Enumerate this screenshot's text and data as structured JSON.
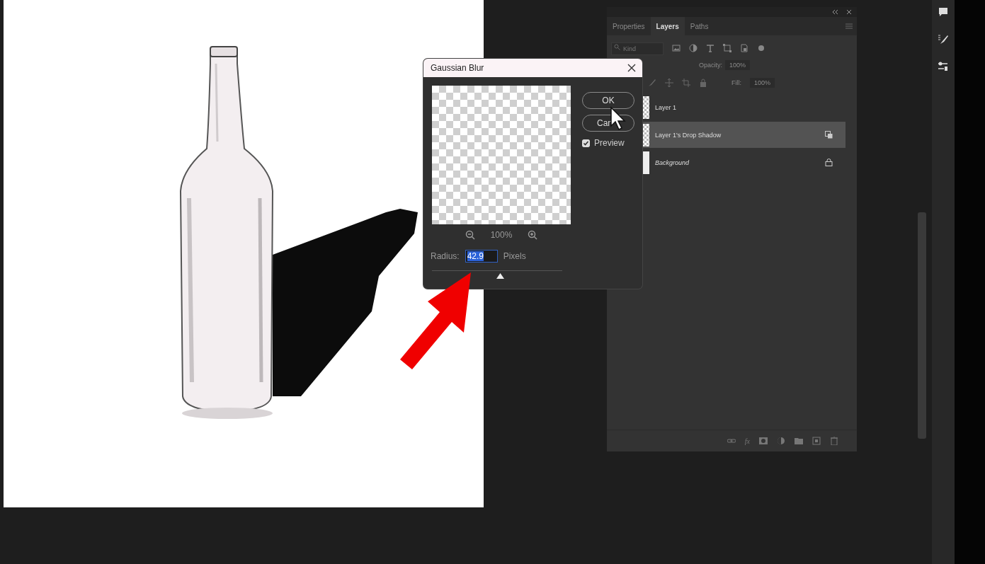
{
  "dialog": {
    "title": "Gaussian Blur",
    "buttons": [
      {
        "label": "OK"
      },
      {
        "label": "Can"
      }
    ],
    "preview": {
      "label": "Preview",
      "checked": true
    },
    "zoom": "100%",
    "radius": {
      "label": "Radius:",
      "value": "42.9",
      "unit": "Pixels"
    },
    "slider": {
      "level": 0.52
    }
  },
  "layers_panel": {
    "tabs": [
      {
        "label": "Properties",
        "selected": false
      },
      {
        "label": "Layers",
        "selected": true
      },
      {
        "label": "Paths",
        "selected": false
      }
    ],
    "filter": {
      "placeholder": "Kind"
    },
    "opacity": {
      "label": "Opacity:",
      "value": "100%"
    },
    "fill": {
      "label": "Fill:",
      "value": "100%"
    },
    "layers": [
      {
        "name": "Layer 1",
        "kind": "layer",
        "selected": false
      },
      {
        "name": "Layer 1's Drop Shadow",
        "kind": "effect",
        "selected": true
      },
      {
        "name": "Background",
        "kind": "background",
        "selected": false
      }
    ],
    "effects_label": "fx"
  }
}
